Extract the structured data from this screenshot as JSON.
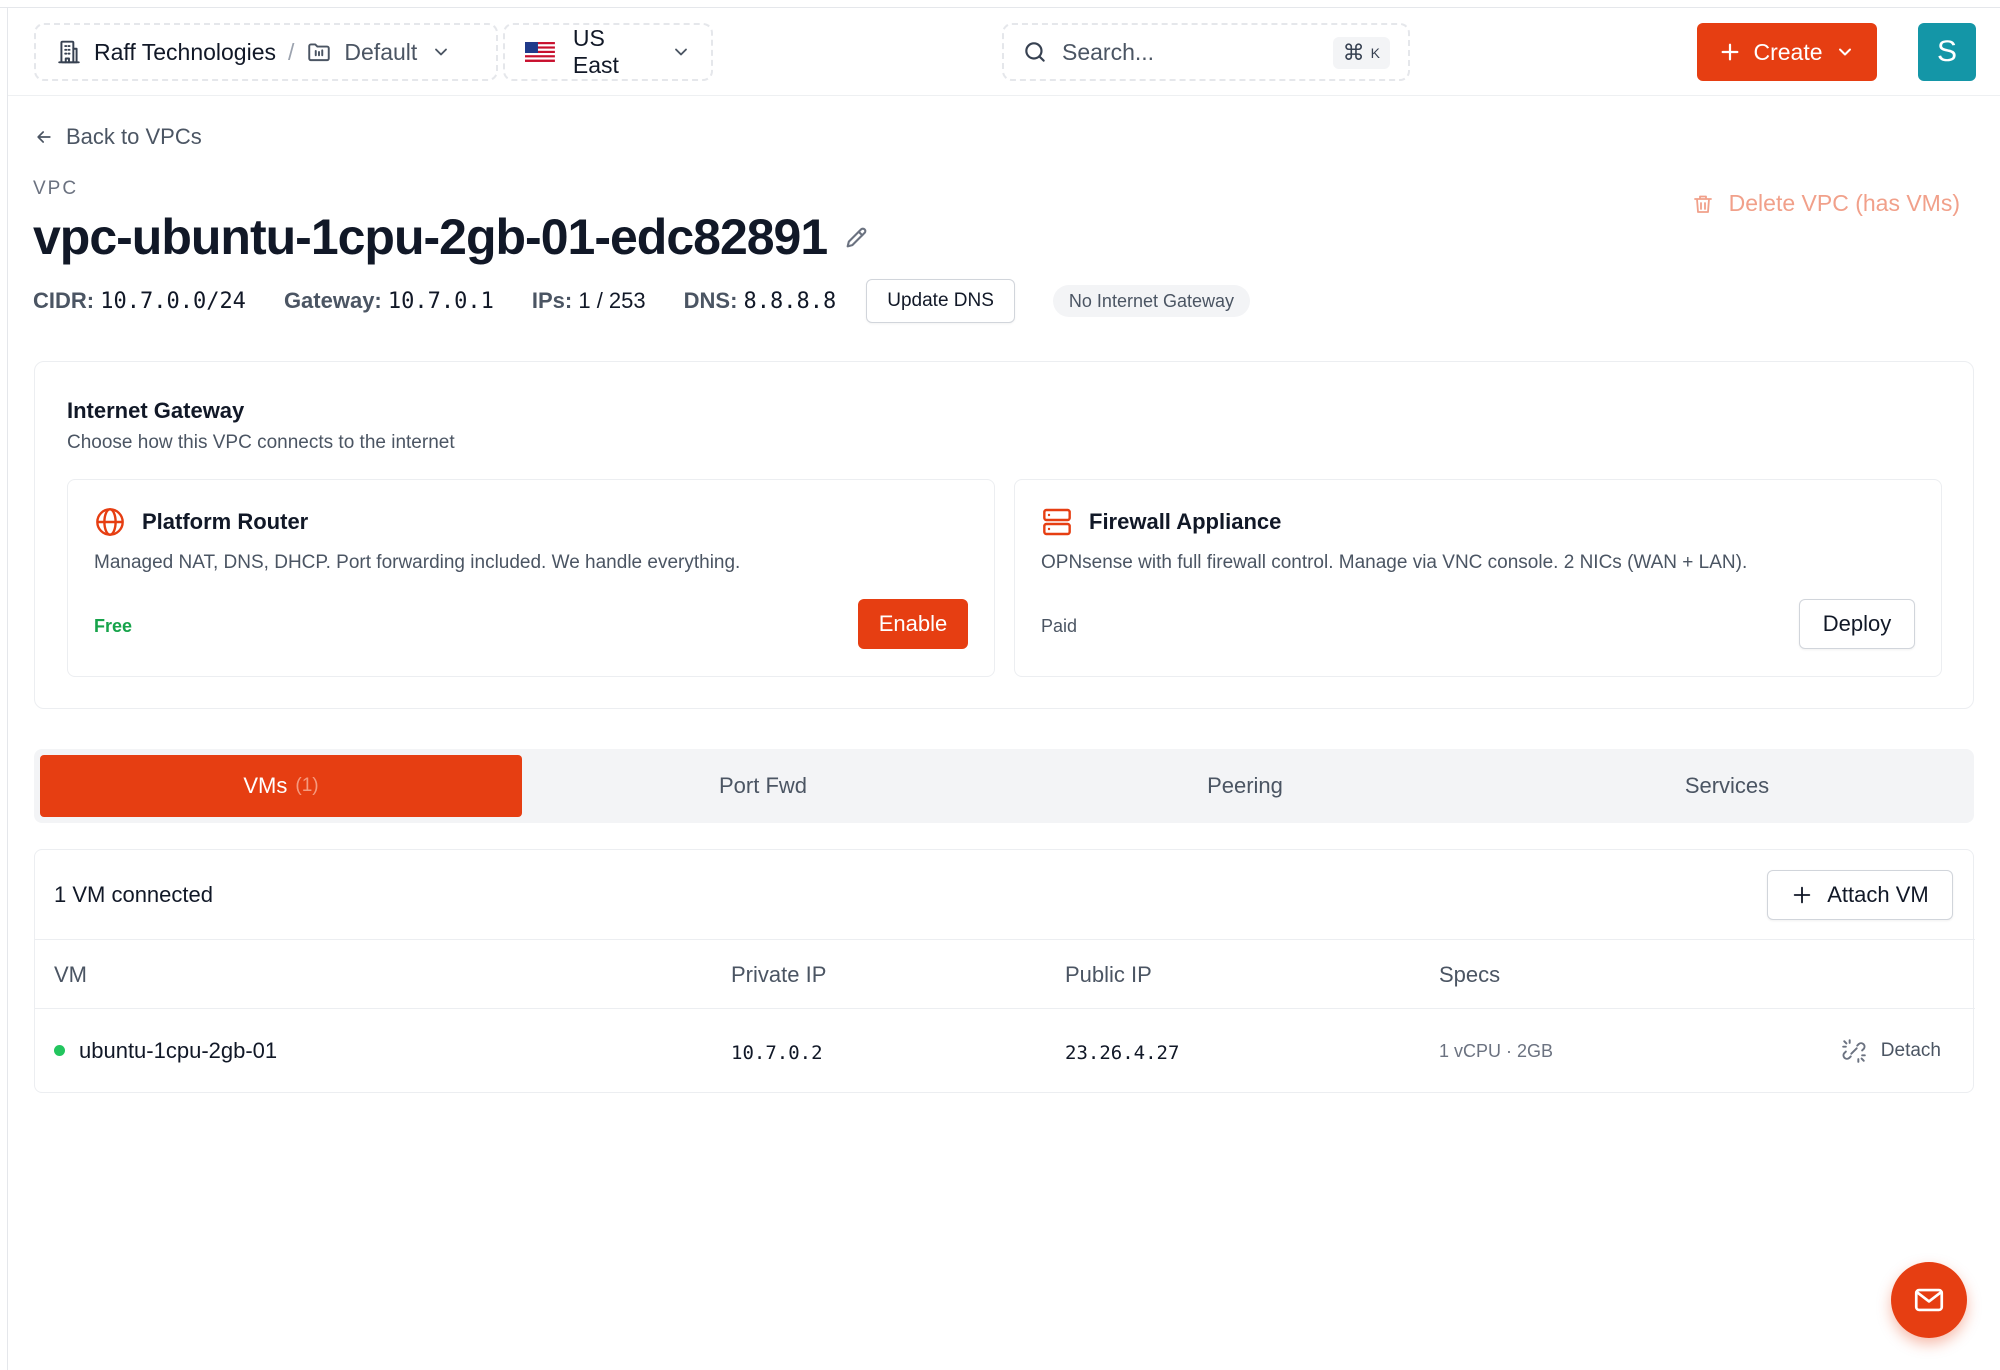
{
  "header": {
    "org_name": "Raff Technologies",
    "separator": "/",
    "project": "Default",
    "region": "US East",
    "search_placeholder": "Search...",
    "search_shortcut_symbol": "⌘",
    "search_shortcut_key": "K",
    "create_label": "Create",
    "avatar_letter": "S"
  },
  "page": {
    "back_label": "Back to VPCs",
    "eyebrow": "VPC",
    "title": "vpc-ubuntu-1cpu-2gb-01-edc82891",
    "delete_label": "Delete VPC (has VMs)"
  },
  "meta": {
    "cidr_label": "CIDR:",
    "cidr_value": "10.7.0.0/24",
    "gateway_label": "Gateway:",
    "gateway_value": "10.7.0.1",
    "ips_label": "IPs:",
    "ips_value": "1 / 253",
    "dns_label": "DNS:",
    "dns_value": "8.8.8.8",
    "update_dns_label": "Update DNS",
    "gateway_badge": "No Internet Gateway"
  },
  "gateway": {
    "title": "Internet Gateway",
    "subtitle": "Choose how this VPC connects to the internet",
    "options": [
      {
        "name": "Platform Router",
        "description": "Managed NAT, DNS, DHCP. Port forwarding included. We handle everything.",
        "price": "Free",
        "action": "Enable"
      },
      {
        "name": "Firewall Appliance",
        "description": "OPNsense with full firewall control. Manage via VNC console. 2 NICs (WAN + LAN).",
        "price": "Paid",
        "action": "Deploy"
      }
    ]
  },
  "tabs": [
    {
      "label": "VMs",
      "count": "(1)"
    },
    {
      "label": "Port Fwd"
    },
    {
      "label": "Peering"
    },
    {
      "label": "Services"
    }
  ],
  "vms": {
    "summary": "1 VM connected",
    "attach_label": "Attach VM",
    "columns": [
      "VM",
      "Private IP",
      "Public IP",
      "Specs"
    ],
    "rows": [
      {
        "name": "ubuntu-1cpu-2gb-01",
        "private_ip": "10.7.0.2",
        "public_ip": "23.26.4.27",
        "specs": "1 vCPU · 2GB",
        "action": "Detach"
      }
    ]
  },
  "colors": {
    "accent": "#e63e12",
    "success": "#22c55e",
    "avatar": "#1496a7",
    "delete_muted": "#f1a08a"
  }
}
